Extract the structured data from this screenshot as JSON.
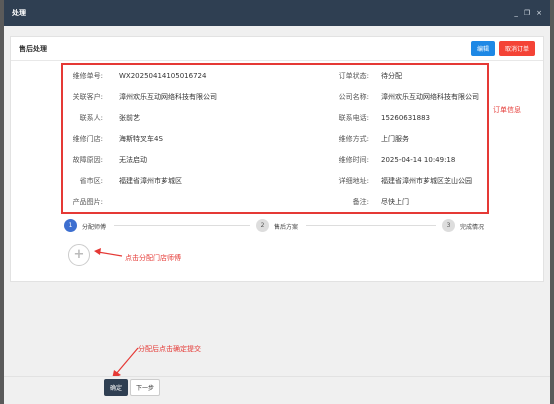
{
  "window": {
    "title": "处理",
    "minimize_glyph": "_",
    "restore_glyph": "❐",
    "close_glyph": "×"
  },
  "panel": {
    "title": "售后处理",
    "edit_label": "编辑",
    "cancel_order_label": "取消订单"
  },
  "order_info": {
    "rows": [
      {
        "left_label": "维修单号:",
        "left_value": "WX20250414105016724",
        "right_label": "订单状态:",
        "right_value": "待分配"
      },
      {
        "left_label": "关联客户:",
        "left_value": "漳州欢乐互动网络科技有限公司",
        "right_label": "公司名称:",
        "right_value": "漳州欢乐互动网络科技有限公司"
      },
      {
        "left_label": "联系人:",
        "left_value": "张前艺",
        "right_label": "联系电话:",
        "right_value": "15260631883"
      },
      {
        "left_label": "维修门店:",
        "left_value": "海斯特叉车4S",
        "right_label": "维修方式:",
        "right_value": "上门服务"
      },
      {
        "left_label": "故障原因:",
        "left_value": "无法启动",
        "right_label": "维修时间:",
        "right_value": "2025-04-14 10:49:18"
      },
      {
        "left_label": "省市区:",
        "left_value": "福建省漳州市芗城区",
        "right_label": "详细地址:",
        "right_value": "福建省漳州市芗城区芝山公园"
      },
      {
        "left_label": "产品图片:",
        "left_value": "",
        "right_label": "备注:",
        "right_value": "尽快上门"
      }
    ]
  },
  "annotations": {
    "order_info": "订单信息",
    "assign_tech": "点击分配门店师傅",
    "submit": "分配后点击确定提交"
  },
  "steps": [
    {
      "num": "1",
      "label": "分配师傅",
      "active": true
    },
    {
      "num": "2",
      "label": "售后方案",
      "active": false
    },
    {
      "num": "3",
      "label": "完成情况",
      "active": false
    }
  ],
  "add_button_glyph": "+",
  "footer": {
    "ok_label": "确定",
    "next_label": "下一步"
  },
  "colors": {
    "accent": "#3d6fd0",
    "annotation": "#e53935",
    "titlebar": "#2f3f52"
  }
}
